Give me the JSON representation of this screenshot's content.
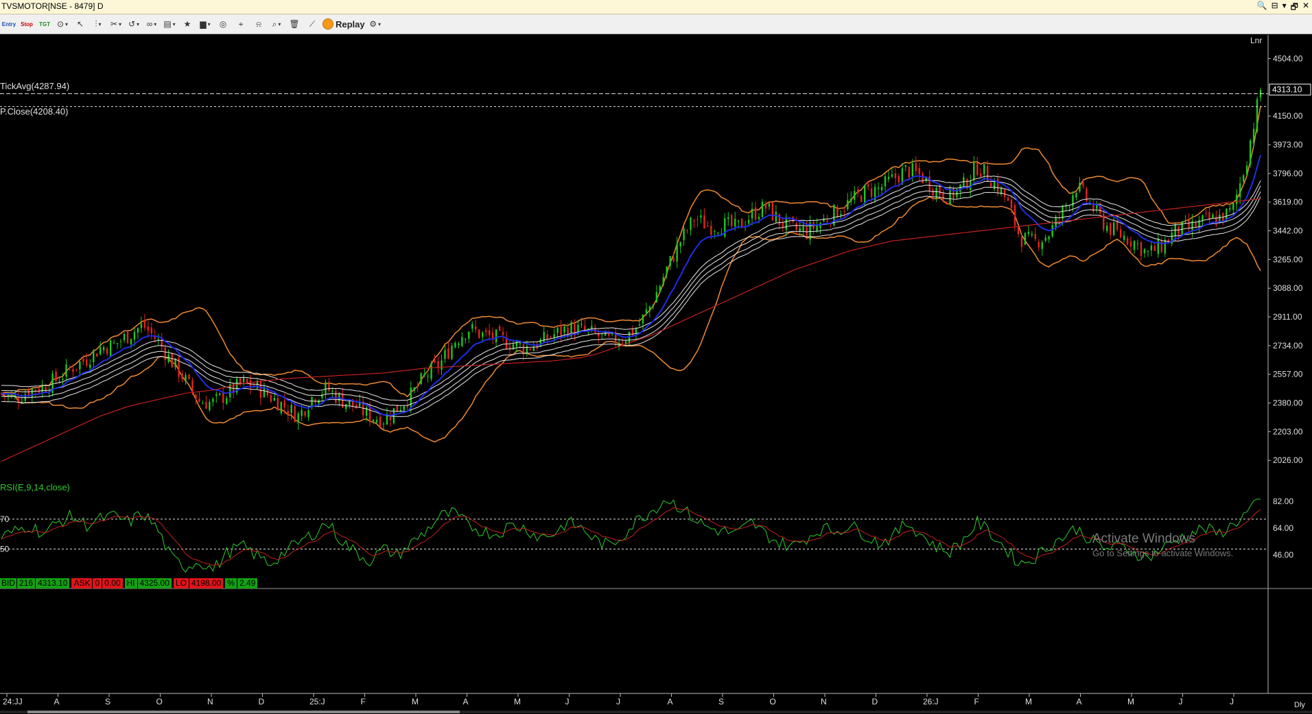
{
  "window": {
    "title": "TVSMOTOR[NSE - 8479] D",
    "controls": [
      "🔍",
      "⊟",
      "▾",
      "🗗",
      "✕"
    ]
  },
  "toolbar": {
    "entry_label": "Entry",
    "stop_label": "Stop",
    "target_label": "TGT",
    "replay_label": "Replay"
  },
  "chart_data": [
    {
      "type": "line",
      "panel": "price",
      "scale_label": "Lnr",
      "y_ticks": [
        "4504.00",
        "4150.00",
        "3973.00",
        "3796.00",
        "3619.00",
        "3442.00",
        "3265.00",
        "3088.00",
        "2911.00",
        "2734.00",
        "2557.00",
        "2380.00",
        "2203.00",
        "2026.00"
      ],
      "ylim": [
        1900,
        4650
      ],
      "last_price": "4313.10",
      "indicators": {
        "tick_avg": "TickAvg(4287.94)",
        "tick_avg_value": 4287.94,
        "prev_close": "P.Close(4208.40)",
        "prev_close_value": 4208.4
      },
      "quote_bar": {
        "bid_label": "BID",
        "bid_qty": "216",
        "bid_price": "4313.10",
        "ask_label": "ASK",
        "ask_qty": "0",
        "ask_price": "0.00",
        "hi_label": "HI",
        "hi_value": "4325.00",
        "lo_label": "LO",
        "lo_value": "4198.00",
        "pct_label": "%",
        "pct_value": "2.49"
      },
      "x_ticks": [
        "24:JJ",
        "A",
        "S",
        "O",
        "N",
        "D",
        "25:J",
        "F",
        "M",
        "A",
        "M",
        "J",
        "J",
        "A",
        "S",
        "O",
        "N",
        "D",
        "26:J",
        "F",
        "M",
        "A",
        "M",
        "J",
        "J"
      ],
      "close_series": [
        2440,
        2410,
        2460,
        2480,
        2530,
        2600,
        2650,
        2720,
        2740,
        2800,
        2860,
        2770,
        2640,
        2520,
        2390,
        2380,
        2440,
        2500,
        2480,
        2420,
        2360,
        2300,
        2420,
        2470,
        2400,
        2360,
        2300,
        2280,
        2350,
        2430,
        2550,
        2620,
        2760,
        2840,
        2800,
        2780,
        2750,
        2720,
        2750,
        2800,
        2840,
        2830,
        2800,
        2760,
        2780,
        2850,
        3000,
        3200,
        3380,
        3520,
        3470,
        3480,
        3460,
        3540,
        3590,
        3500,
        3450,
        3440,
        3500,
        3560,
        3620,
        3680,
        3700,
        3760,
        3820,
        3780,
        3700,
        3650,
        3720,
        3840,
        3760,
        3640,
        3400,
        3370,
        3420,
        3560,
        3720,
        3600,
        3480,
        3420,
        3380,
        3300,
        3350,
        3440,
        3460,
        3500,
        3520,
        3560,
        3880,
        4313
      ],
      "ma_200_series": [
        2020,
        2060,
        2100,
        2140,
        2180,
        2220,
        2260,
        2300,
        2330,
        2360,
        2380,
        2400,
        2420,
        2440,
        2450,
        2460,
        2480,
        2500,
        2510,
        2520,
        2530,
        2535,
        2540,
        2545,
        2550,
        2555,
        2560,
        2565,
        2575,
        2585,
        2595,
        2600,
        2605,
        2610,
        2615,
        2620,
        2625,
        2630,
        2635,
        2640,
        2650,
        2660,
        2680,
        2710,
        2740,
        2770,
        2800,
        2840,
        2880,
        2920,
        2960,
        3000,
        3040,
        3080,
        3120,
        3160,
        3200,
        3230,
        3260,
        3290,
        3320,
        3340,
        3360,
        3380,
        3390,
        3400,
        3410,
        3420,
        3430,
        3440,
        3450,
        3460,
        3470,
        3480,
        3490,
        3500,
        3510,
        3520,
        3530,
        3540,
        3550,
        3560,
        3570,
        3580,
        3590,
        3600,
        3610,
        3620,
        3630,
        3640
      ]
    },
    {
      "type": "line",
      "panel": "rsi",
      "title": "RSI(E,9,14,close)",
      "y_ticks": [
        "82.00",
        "64.00",
        "46.00"
      ],
      "ylim": [
        36,
        92
      ],
      "levels": [
        {
          "label": "70",
          "value": 70
        },
        {
          "label": "50",
          "value": 50
        }
      ],
      "rsi_series": [
        58,
        62,
        66,
        60,
        68,
        72,
        66,
        70,
        72,
        68,
        74,
        64,
        44,
        38,
        42,
        36,
        48,
        52,
        46,
        40,
        48,
        54,
        60,
        68,
        56,
        48,
        42,
        50,
        46,
        54,
        62,
        72,
        74,
        66,
        62,
        60,
        66,
        64,
        58,
        60,
        68,
        64,
        56,
        52,
        60,
        70,
        76,
        84,
        78,
        70,
        64,
        62,
        60,
        68,
        60,
        54,
        52,
        58,
        64,
        62,
        66,
        60,
        54,
        58,
        68,
        60,
        52,
        48,
        56,
        68,
        60,
        50,
        40,
        44,
        52,
        58,
        64,
        56,
        50,
        52,
        48,
        44,
        50,
        56,
        60,
        64,
        60,
        66,
        74,
        82
      ]
    }
  ],
  "watermark": {
    "line1": "Activate Windows",
    "line2": "Go to Settings to activate Windows."
  },
  "corner_label": "Dly"
}
